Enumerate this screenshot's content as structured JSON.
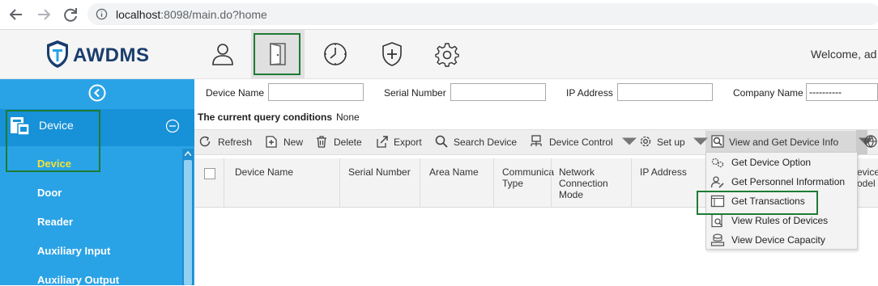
{
  "browser": {
    "url_host": "localhost",
    "url_rest": ":8098/main.do?home"
  },
  "header": {
    "logo_text": "AWDMS",
    "welcome": "Welcome, ad",
    "modules": [
      "person-icon",
      "door-icon",
      "clock-icon",
      "shield-plus-icon",
      "gear-icon"
    ]
  },
  "sidebar": {
    "group_label": "Device",
    "items": [
      "Device",
      "Door",
      "Reader",
      "Auxiliary Input",
      "Auxiliary Output"
    ]
  },
  "filters": {
    "device_name_label": "Device Name",
    "serial_number_label": "Serial Number",
    "ip_address_label": "IP Address",
    "company_name_label": "Company Name",
    "company_name_value": "----------",
    "query_label": "The current query conditions",
    "query_value": "None"
  },
  "toolbar": {
    "refresh": "Refresh",
    "new": "New",
    "delete": "Delete",
    "export": "Export",
    "search_device": "Search Device",
    "device_control": "Device Control",
    "set_up": "Set up",
    "view_get_info": "View and Get Device Info"
  },
  "table": {
    "columns": [
      "Device Name",
      "Serial Number",
      "Area Name",
      "Communica\nType",
      "Network\nConnection\nMode",
      "IP Address",
      "evice\nodel"
    ]
  },
  "dropdown": {
    "items": [
      "Get Device Option",
      "Get Personnel Information",
      "Get Transactions",
      "View Rules of Devices",
      "View Device Capacity"
    ]
  },
  "colors": {
    "sidebar": "#2aa3e6",
    "sidebar_group": "#1791d7",
    "active_item": "#f4e234",
    "highlight_box": "#1e7b34"
  }
}
